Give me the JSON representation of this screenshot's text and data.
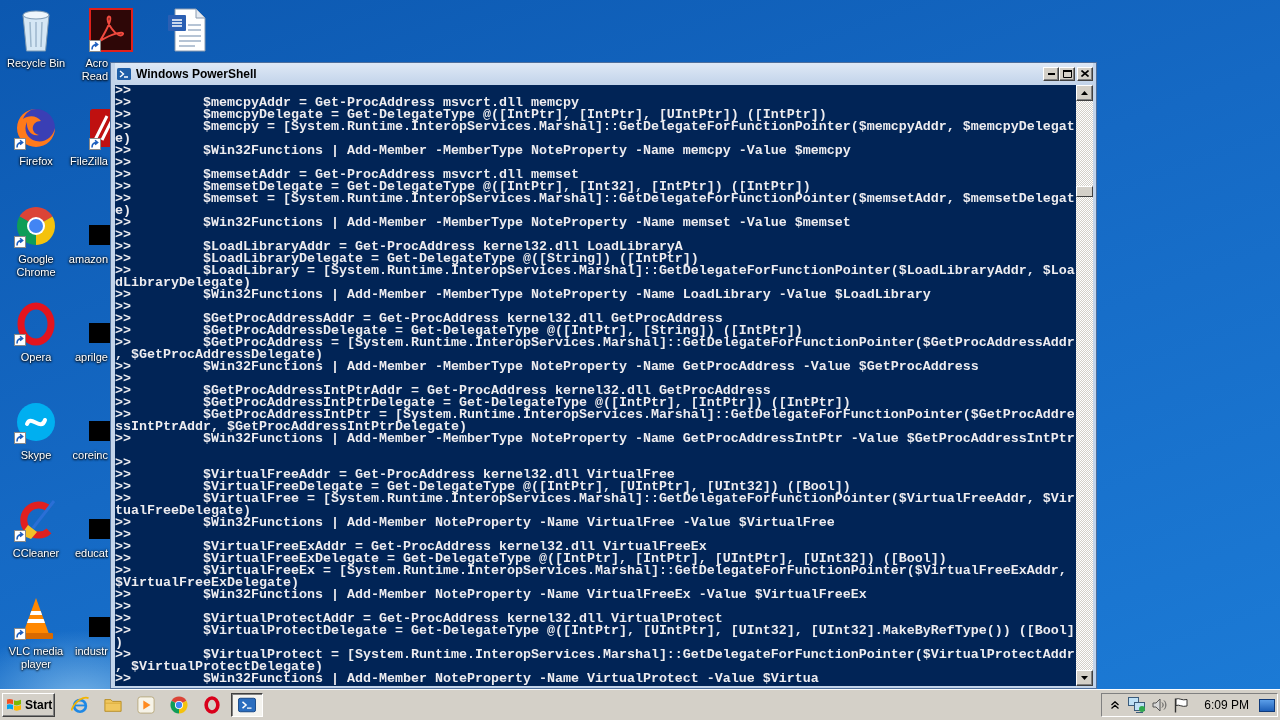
{
  "desktop": {
    "columns": [
      {
        "icons": [
          {
            "kind": "recycle_bin",
            "label": "Recycle Bin",
            "shortcut": false
          },
          {
            "kind": "firefox",
            "label": "Firefox",
            "shortcut": true
          },
          {
            "kind": "chrome",
            "label": "Google Chrome",
            "shortcut": true
          },
          {
            "kind": "opera",
            "label": "Opera",
            "shortcut": true
          },
          {
            "kind": "skype",
            "label": "Skype",
            "shortcut": true
          },
          {
            "kind": "ccleaner",
            "label": "CCleaner",
            "shortcut": true
          },
          {
            "kind": "vlc",
            "label": "VLC media player",
            "shortcut": true
          }
        ]
      },
      {
        "icons": [
          {
            "kind": "acrobat",
            "label": "Acro Read",
            "shortcut": true
          },
          {
            "kind": "filezilla",
            "label": "FileZilla",
            "shortcut": true
          },
          {
            "kind": "file",
            "label": "amazon",
            "shortcut": false
          },
          {
            "kind": "file",
            "label": "aprilge",
            "shortcut": false
          },
          {
            "kind": "file",
            "label": "coreinc",
            "shortcut": false
          },
          {
            "kind": "file",
            "label": "educat",
            "shortcut": false
          },
          {
            "kind": "file",
            "label": "industr",
            "shortcut": false
          }
        ]
      },
      {
        "icons": [
          {
            "kind": "word",
            "shortcut": false
          }
        ]
      }
    ]
  },
  "window": {
    "title": "Windows PowerShell",
    "console": {
      "rows": [
        {
          "kind": "text",
          "text": ">>"
        },
        {
          "kind": "text",
          "text": ">>         $memcpyAddr = Get-ProcAddress msvcrt.dll memcpy"
        },
        {
          "kind": "text",
          "text": ">>         $memcpyDelegate = Get-DelegateType @([IntPtr], [IntPtr], [UIntPtr]) ([IntPtr])"
        },
        {
          "kind": "text",
          "text": ">>         $memcpy = [System.Runtime.InteropServices.Marshal]::GetDelegateForFunctionPointer($memcpyAddr, $memcpyDelegat"
        },
        {
          "kind": "text",
          "text": "e)"
        },
        {
          "kind": "text",
          "text": ">>         $Win32Functions | Add-Member -MemberType NoteProperty -Name memcpy -Value $memcpy"
        },
        {
          "kind": "text",
          "text": ">>"
        },
        {
          "kind": "text",
          "text": ">>         $memsetAddr = Get-ProcAddress msvcrt.dll memset"
        },
        {
          "kind": "text",
          "text": ">>         $memsetDelegate = Get-DelegateType @([IntPtr], [Int32], [IntPtr]) ([IntPtr])"
        },
        {
          "kind": "text",
          "text": ">>         $memset = [System.Runtime.InteropServices.Marshal]::GetDelegateForFunctionPointer($memsetAddr, $memsetDelegat"
        },
        {
          "kind": "text",
          "text": "e)"
        },
        {
          "kind": "text",
          "text": ">>         $Win32Functions | Add-Member -MemberType NoteProperty -Name memset -Value $memset"
        },
        {
          "kind": "text",
          "text": ">>"
        },
        {
          "kind": "text",
          "text": ">>         $LoadLibraryAddr = Get-ProcAddress kernel32.dll LoadLibraryA"
        },
        {
          "kind": "text",
          "text": ">>         $LoadLibraryDelegate = Get-DelegateType @([String]) ([IntPtr])"
        },
        {
          "kind": "text",
          "text": ">>         $LoadLibrary = [System.Runtime.InteropServices.Marshal]::GetDelegateForFunctionPointer($LoadLibraryAddr, $Loa"
        },
        {
          "kind": "text",
          "text": "dLibraryDelegate)"
        },
        {
          "kind": "text",
          "text": ">>         $Win32Functions | Add-Member -MemberType NoteProperty -Name LoadLibrary -Value $LoadLibrary"
        },
        {
          "kind": "text",
          "text": ">>"
        },
        {
          "kind": "text",
          "text": ">>         $GetProcAddressAddr = Get-ProcAddress kernel32.dll GetProcAddress"
        },
        {
          "kind": "text",
          "text": ">>         $GetProcAddressDelegate = Get-DelegateType @([IntPtr], [String]) ([IntPtr])"
        },
        {
          "kind": "text",
          "text": ">>         $GetProcAddress = [System.Runtime.InteropServices.Marshal]::GetDelegateForFunctionPointer($GetProcAddressAddr"
        },
        {
          "kind": "text",
          "text": ", $GetProcAddressDelegate)"
        },
        {
          "kind": "text",
          "text": ">>         $Win32Functions | Add-Member -MemberType NoteProperty -Name GetProcAddress -Value $GetProcAddress"
        },
        {
          "kind": "text",
          "text": ">>"
        },
        {
          "kind": "text",
          "text": ">>         $GetProcAddressIntPtrAddr = Get-ProcAddress kernel32.dll GetProcAddress"
        },
        {
          "kind": "text",
          "text": ">>         $GetProcAddressIntPtrDelegate = Get-DelegateType @([IntPtr], [IntPtr]) ([IntPtr])"
        },
        {
          "kind": "text",
          "text": ">>         $GetProcAddressIntPtr = [System.Runtime.InteropServices.Marshal]::GetDelegateForFunctionPointer($GetProcAddre"
        },
        {
          "kind": "text",
          "text": "ssIntPtrAddr, $GetProcAddressIntPtrDelegate)"
        },
        {
          "kind": "text",
          "text": ">>         $Win32Functions | Add-Member -MemberType NoteProperty -Name GetProcAddressIntPtr -Value $GetProcAddressIntPtr"
        },
        {
          "kind": "blank"
        },
        {
          "kind": "text",
          "text": ">>"
        },
        {
          "kind": "text",
          "text": ">>         $VirtualFreeAddr = Get-ProcAddress kernel32.dll VirtualFree"
        },
        {
          "kind": "text",
          "text": ">>         $VirtualFreeDelegate = Get-DelegateType @([IntPtr], [UIntPtr], [UInt32]) ([Bool])"
        },
        {
          "kind": "text",
          "text": ">>         $VirtualFree = [System.Runtime.InteropServices.Marshal]::GetDelegateForFunctionPointer($VirtualFreeAddr, $Vir"
        },
        {
          "kind": "text",
          "text": "tualFreeDelegate)"
        },
        {
          "kind": "text",
          "text": ">>         $Win32Functions | Add-Member NoteProperty -Name VirtualFree -Value $VirtualFree"
        },
        {
          "kind": "text",
          "text": ">>"
        },
        {
          "kind": "text",
          "text": ">>         $VirtualFreeExAddr = Get-ProcAddress kernel32.dll VirtualFreeEx"
        },
        {
          "kind": "text",
          "text": ">>         $VirtualFreeExDelegate = Get-DelegateType @([IntPtr], [IntPtr], [UIntPtr], [UInt32]) ([Bool])"
        },
        {
          "kind": "text",
          "text": ">>         $VirtualFreeEx = [System.Runtime.InteropServices.Marshal]::GetDelegateForFunctionPointer($VirtualFreeExAddr,"
        },
        {
          "kind": "text",
          "text": "$VirtualFreeExDelegate)"
        },
        {
          "kind": "text",
          "text": ">>         $Win32Functions | Add-Member NoteProperty -Name VirtualFreeEx -Value $VirtualFreeEx"
        },
        {
          "kind": "text",
          "text": ">>"
        },
        {
          "kind": "text",
          "text": ">>         $VirtualProtectAddr = Get-ProcAddress kernel32.dll VirtualProtect"
        },
        {
          "kind": "text",
          "text": ">>         $VirtualProtectDelegate = Get-DelegateType @([IntPtr], [UIntPtr], [UInt32], [UInt32].MakeByRefType()) ([Bool]"
        },
        {
          "kind": "text",
          "text": ")"
        },
        {
          "kind": "text",
          "text": ">>         $VirtualProtect = [System.Runtime.InteropServices.Marshal]::GetDelegateForFunctionPointer($VirtualProtectAddr"
        },
        {
          "kind": "text",
          "text": ", $VirtualProtectDelegate)"
        },
        {
          "kind": "text",
          "text": ">>         $Win32Functions | Add-Member NoteProperty -Name VirtualProtect -Value $Virtua"
        }
      ]
    }
  },
  "taskbar": {
    "start": "Start",
    "items": [
      {
        "kind": "ie",
        "selected": false
      },
      {
        "kind": "folder",
        "selected": false
      },
      {
        "kind": "media",
        "selected": false
      },
      {
        "kind": "chrome",
        "selected": false
      },
      {
        "kind": "opera",
        "selected": false
      },
      {
        "kind": "powershell",
        "selected": true
      }
    ],
    "clock": "6:09 PM"
  }
}
